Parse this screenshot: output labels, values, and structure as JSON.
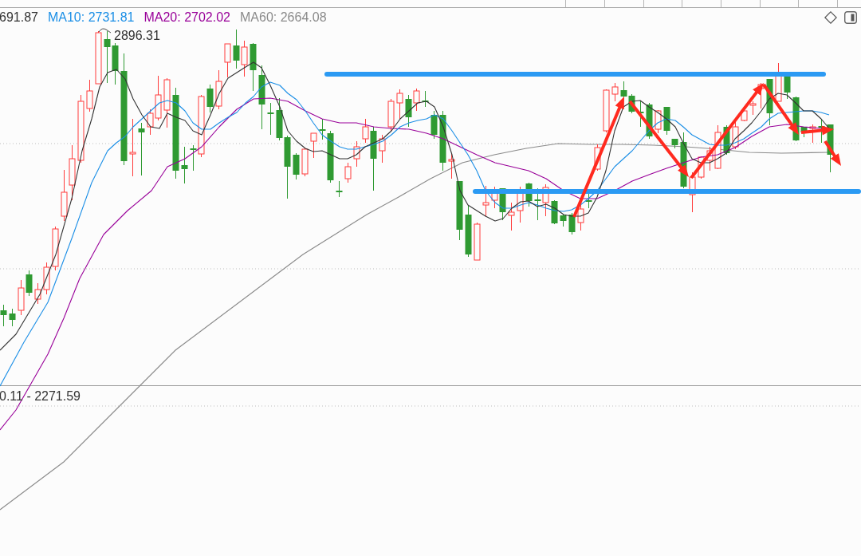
{
  "legend": [
    {
      "text": "691.87",
      "color": "#333333"
    },
    {
      "text": "MA10: 2731.81",
      "color": "#1a8ee6"
    },
    {
      "text": "MA20: 2702.02",
      "color": "#990099"
    },
    {
      "text": "MA60: 2664.08",
      "color": "#8a8a8a"
    }
  ],
  "chart": {
    "high_label": "2896.31",
    "lower_pane_label": "0.11 - 2271.59"
  }
}
